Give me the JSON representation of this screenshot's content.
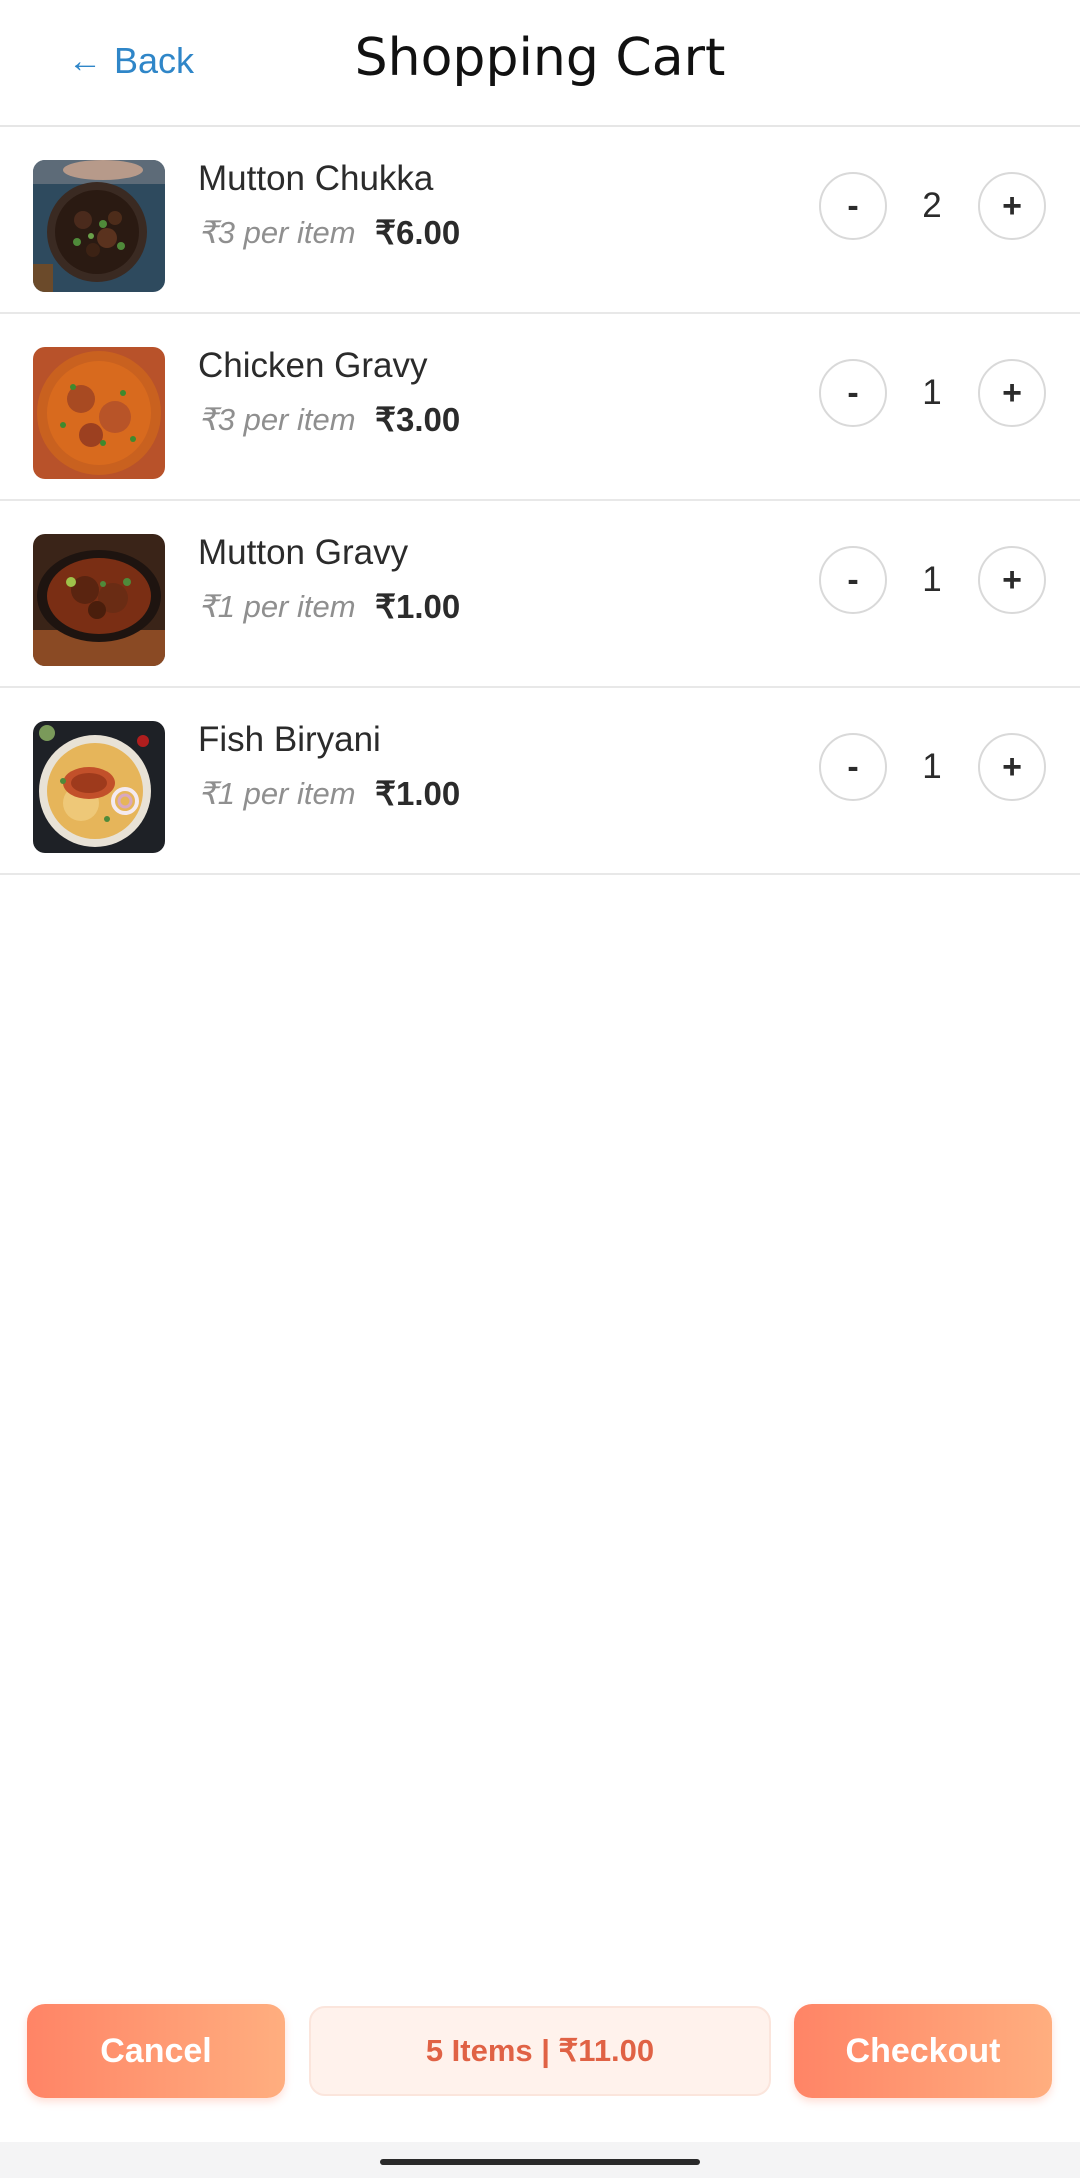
{
  "header": {
    "back_label": "Back",
    "title": "Shopping Cart"
  },
  "cart": {
    "items": [
      {
        "name": "Mutton Chukka",
        "unit_price": "₹3 per item",
        "total": "₹6.00",
        "quantity": "2",
        "minus": "-",
        "plus": "+"
      },
      {
        "name": "Chicken Gravy",
        "unit_price": "₹3 per item",
        "total": "₹3.00",
        "quantity": "1",
        "minus": "-",
        "plus": "+"
      },
      {
        "name": "Mutton Gravy",
        "unit_price": "₹1 per item",
        "total": "₹1.00",
        "quantity": "1",
        "minus": "-",
        "plus": "+"
      },
      {
        "name": "Fish Biryani",
        "unit_price": "₹1 per item",
        "total": "₹1.00",
        "quantity": "1",
        "minus": "-",
        "plus": "+"
      }
    ]
  },
  "footer": {
    "cancel_label": "Cancel",
    "summary": "5 Items | ₹11.00",
    "checkout_label": "Checkout"
  },
  "colors": {
    "accent": "#ff8466",
    "accent_light": "#ffae7f",
    "link": "#2f86c8",
    "summary_text": "#e06245"
  }
}
